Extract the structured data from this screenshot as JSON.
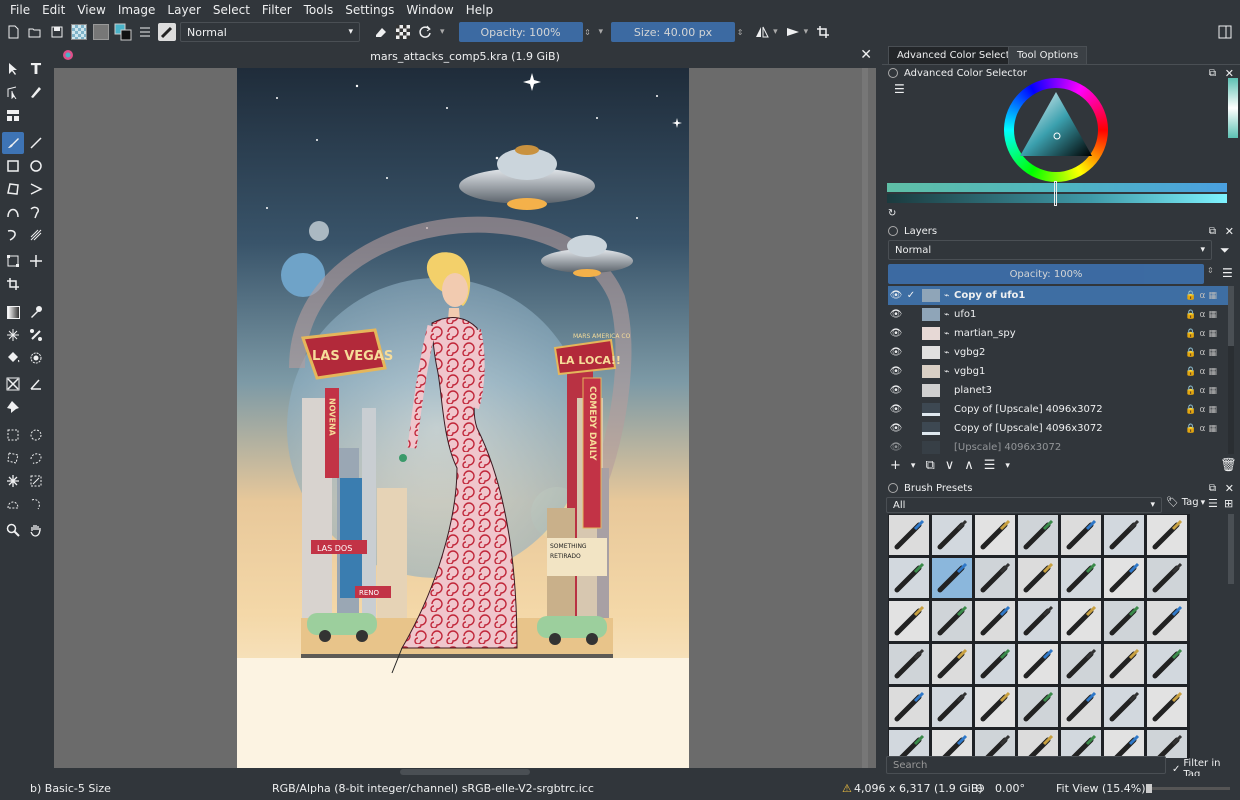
{
  "menu": [
    "File",
    "Edit",
    "View",
    "Image",
    "Layer",
    "Select",
    "Filter",
    "Tools",
    "Settings",
    "Window",
    "Help"
  ],
  "toolbar": {
    "blend_mode": "Normal",
    "opacity": "Opacity: 100%",
    "size": "Size: 40.00 px"
  },
  "document": {
    "tab_title": "mars_attacks_comp5.kra (1.9 GiB)"
  },
  "art": {
    "sign_left": "LAS VEGAS",
    "sign_left_vertical": "NOVENA",
    "sign_right": "LA LOCA!!",
    "sign_right_top": "MARS AMERICA CO",
    "sign_right_vertical": "COMEDY DAILY",
    "billboard_1": "LAS DOS",
    "billboard_2": "SOMETHING",
    "billboard_3": "RETIRADO",
    "billboard_4": "RENO"
  },
  "colors": {
    "accent": "#3e74b5",
    "selected_row": "#3e6ea3",
    "bg": "#31363b"
  },
  "docker": {
    "tabs": [
      "Advanced Color Selector",
      "Tool Options"
    ],
    "color_selector_title": "Advanced Color Selector",
    "layers_title": "Layers",
    "layers_blend": "Normal",
    "layers_opacity": "Opacity: 100%",
    "layers": [
      {
        "name": "Copy of ufo1",
        "selected": true
      },
      {
        "name": "ufo1",
        "selected": false
      },
      {
        "name": "martian_spy",
        "selected": false
      },
      {
        "name": "vgbg2",
        "selected": false
      },
      {
        "name": "vgbg1",
        "selected": false
      },
      {
        "name": "planet3",
        "selected": false
      },
      {
        "name": "Copy of [Upscale] 4096x3072",
        "selected": false
      },
      {
        "name": "Copy of [Upscale] 4096x3072",
        "selected": false
      },
      {
        "name": "[Upscale] 4096x3072",
        "selected": false
      }
    ],
    "brush_title": "Brush Presets",
    "brush_filter": "All",
    "brush_tag": "Tag",
    "brush_search_placeholder": "Search",
    "filter_in_tag": "Filter in Tag"
  },
  "status": {
    "brush": "b) Basic-5 Size",
    "color_model": "RGB/Alpha (8-bit integer/channel)  sRGB-elle-V2-srgbtrc.icc",
    "dims": "4,096 x 6,317 (1.9 GiB)",
    "rotation": "0.00°",
    "zoom": "Fit View (15.4%)"
  }
}
